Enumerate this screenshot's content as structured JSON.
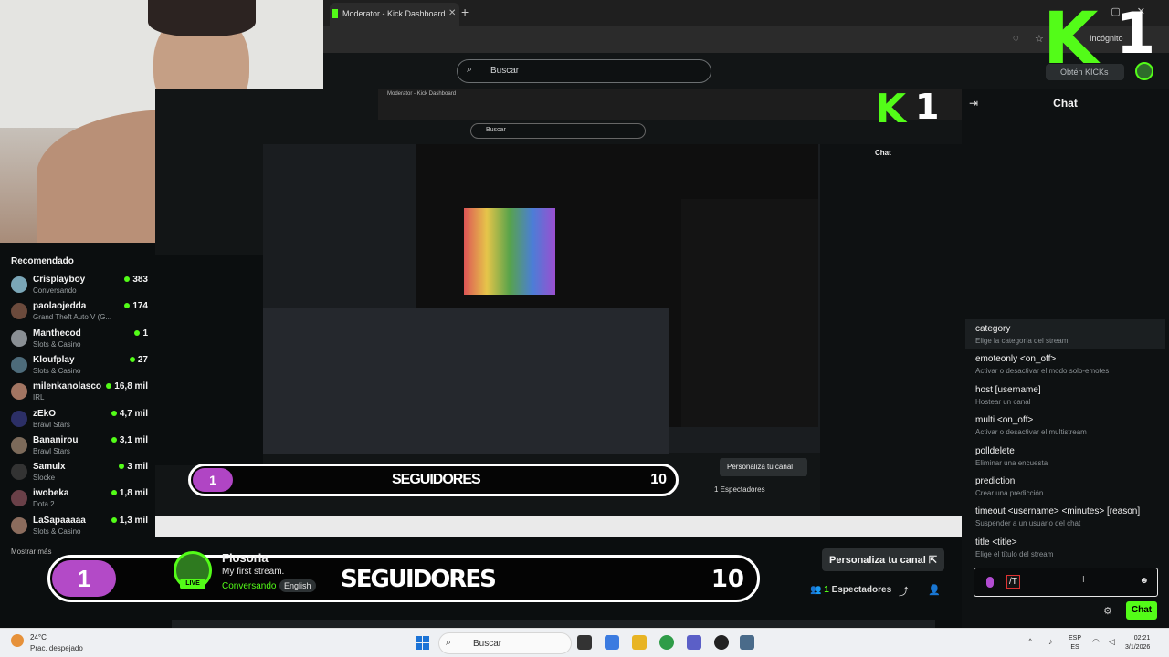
{
  "browser": {
    "tab_title": "Moderator - Kick Dashboard",
    "incognito": "Incógnito"
  },
  "header": {
    "search_placeholder": "Buscar",
    "kicks_label": "Obtén KICKs"
  },
  "overlay_logo": {
    "letter": "K",
    "number": "1"
  },
  "sidebar": {
    "title": "Recomendado",
    "items": [
      {
        "name": "Crisplayboy",
        "category": "Conversando",
        "viewers": "383"
      },
      {
        "name": "paolaojedda",
        "category": "Grand Theft Auto V (G...",
        "viewers": "174"
      },
      {
        "name": "Manthecod",
        "category": "Slots & Casino",
        "viewers": "1"
      },
      {
        "name": "Kloufplay",
        "category": "Slots & Casino",
        "viewers": "27"
      },
      {
        "name": "milenkanolasco",
        "category": "IRL",
        "viewers": "16,8 mil"
      },
      {
        "name": "zEkO",
        "category": "Brawl Stars",
        "viewers": "4,7 mil"
      },
      {
        "name": "Bananirou",
        "category": "Brawl Stars",
        "viewers": "3,1 mil"
      },
      {
        "name": "Samulx",
        "category": "Slocke I",
        "viewers": "3 mil"
      },
      {
        "name": "iwobeka",
        "category": "Dota 2",
        "viewers": "1,8 mil"
      },
      {
        "name": "LaSapaaaaa",
        "category": "Slots & Casino",
        "viewers": "1,3 mil"
      }
    ],
    "show_more": "Mostrar más"
  },
  "nested": {
    "chat_title": "Chat",
    "search": "Buscar",
    "banner_number": "1",
    "banner_text": "SEGUIDORES",
    "banner_count": "10",
    "personaliza": "Personaliza tu canal",
    "espectadores": "1 Espectadores"
  },
  "stream": {
    "follower_number": "1",
    "banner_text": "SEGUIDORES",
    "banner_count": "10",
    "streamer": "Flosoria",
    "title": "My first stream.",
    "category": "Conversando",
    "language": "English",
    "live": "LIVE",
    "customize_button": "Personaliza tu canal",
    "viewer_count": "1",
    "viewer_label": "Espectadores"
  },
  "chat": {
    "title": "Chat",
    "commands": [
      {
        "name": "category",
        "desc": "Elige la categoría del stream"
      },
      {
        "name": "emoteonly <on_off>",
        "desc": "Activar o desactivar el modo solo-emotes"
      },
      {
        "name": "host [username]",
        "desc": "Hostear un canal"
      },
      {
        "name": "multi <on_off>",
        "desc": "Activar o desactivar el multistream"
      },
      {
        "name": "polldelete",
        "desc": "Eliminar una encuesta"
      },
      {
        "name": "prediction",
        "desc": "Crear una predicción"
      },
      {
        "name": "timeout <username> <minutes> [reason]",
        "desc": "Suspender a un usuario del chat"
      },
      {
        "name": "title <title>",
        "desc": "Elige el título del stream"
      }
    ],
    "input_value": "/T",
    "send_label": "Chat"
  },
  "taskbar": {
    "temperature": "24°C",
    "weather": "Prac. despejado",
    "search": "Buscar",
    "lang1": "ESP",
    "lang2": "ES",
    "time": "02:21",
    "date": "3/1/2026"
  },
  "colors": {
    "accent": "#53fc18",
    "follower_pill": "#b34ac7"
  }
}
